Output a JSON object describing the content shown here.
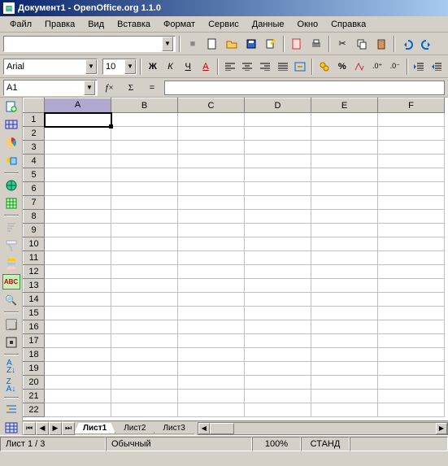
{
  "title": "Документ1 - OpenOffice.org 1.1.0",
  "menu": [
    "Файл",
    "Правка",
    "Вид",
    "Вставка",
    "Формат",
    "Сервис",
    "Данные",
    "Окно",
    "Справка"
  ],
  "toolbar1_combo": "",
  "font": {
    "name": "Arial",
    "size": "10"
  },
  "fmt": {
    "bold": "Ж",
    "italic": "К",
    "underline": "Ч",
    "strike": "А"
  },
  "cellref": {
    "value": "A1"
  },
  "columns": [
    "A",
    "B",
    "C",
    "D",
    "E",
    "F"
  ],
  "rows": [
    "1",
    "2",
    "3",
    "4",
    "5",
    "6",
    "7",
    "8",
    "9",
    "10",
    "11",
    "12",
    "13",
    "14",
    "15",
    "16",
    "17",
    "18",
    "19",
    "20",
    "21",
    "22"
  ],
  "tabs": {
    "active": "Лист1",
    "others": [
      "Лист2",
      "Лист3"
    ]
  },
  "status": {
    "sheet": "Лист 1 / 3",
    "style": "Обычный",
    "zoom": "100%",
    "std": "СТАНД"
  }
}
